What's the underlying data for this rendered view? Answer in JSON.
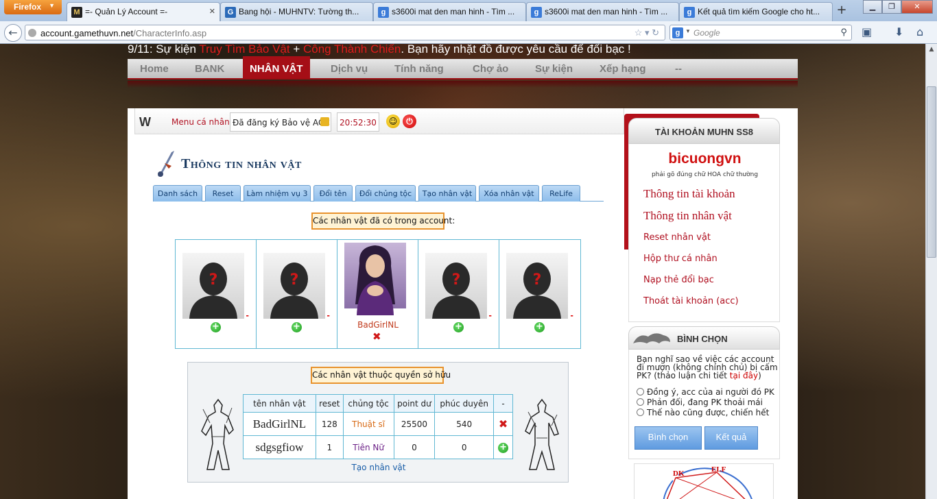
{
  "browser": {
    "menu_button": "Firefox",
    "tabs": [
      {
        "title": "=- Quản Lý Account =-",
        "active": true
      },
      {
        "title": "Bang hội - MUHNTV: Tường th...",
        "active": false
      },
      {
        "title": "s3600i mat den man hinh - Tìm ...",
        "active": false
      },
      {
        "title": "s3600i mat den man hinh - Tìm ...",
        "active": false
      },
      {
        "title": "Kết quả tìm kiếm Google cho ht...",
        "active": false
      }
    ],
    "url_host": "account.gamethuvn.net",
    "url_path": "/CharacterInfo.asp",
    "search_placeholder": "Google"
  },
  "news": {
    "prefix": "9/11: Sự kiện ",
    "event1": "Truy Tìm Bảo Vật",
    "plus": " + ",
    "event2": "Công Thành Chiến",
    "suffix": ". Bạn hãy nhặt đồ được yêu cầu để đổi bạc !"
  },
  "main_nav": [
    "Home",
    "BANK",
    "NHÂN VẬT",
    "Dịch vụ",
    "Tính năng",
    "Chợ ảo",
    "Sự kiện",
    "Xếp hạng",
    "--"
  ],
  "main_nav_active": "NHÂN VẬT",
  "topbar": {
    "menu_label": "Menu cá nhân",
    "account_status": "Đã đăng ký Bảo vệ ACC",
    "clock": "20:52:30"
  },
  "page_title": "Thông tin nhân vật",
  "sub_tabs": [
    "Danh sách",
    "Reset",
    "Làm nhiệm vụ 3",
    "Đổi tên",
    "Đổi chủng tộc",
    "Tạo nhân vật",
    "Xóa nhân vật",
    "ReLife"
  ],
  "slots_label": "Các nhân vật đã có trong account:",
  "slots": [
    {
      "filled": false,
      "name": "",
      "dash": "-"
    },
    {
      "filled": false,
      "name": "",
      "dash": "-"
    },
    {
      "filled": true,
      "name": "BadGirlNL",
      "dash": ""
    },
    {
      "filled": false,
      "name": "",
      "dash": "-"
    },
    {
      "filled": false,
      "name": "",
      "dash": "-"
    }
  ],
  "owned_label": "Các nhân vật thuộc quyền sở hữu",
  "table": {
    "headers": [
      "tên nhân vật",
      "reset",
      "chủng tộc",
      "point dư",
      "phúc duyên",
      "-"
    ],
    "rows": [
      {
        "name": "BadGirlNL",
        "reset": "128",
        "race": "Thuật sĩ",
        "point": "25500",
        "phuc": "540",
        "action": "delete"
      },
      {
        "name": "sdgsgfiow",
        "reset": "1",
        "race": "Tiên Nữ",
        "point": "0",
        "phuc": "0",
        "action": "add"
      }
    ]
  },
  "create_link": "Tạo nhân vật",
  "sidebar": {
    "header": "TÀI KHOẢN MUHN SS8",
    "username": "bicuongvn",
    "hint": "phải gõ đúng chữ HOA chữ thường",
    "links": [
      "Thông tin tài khoản",
      "Thông tin nhân vật",
      "Reset nhân vật",
      "Hộp thư cá nhân",
      "Nạp thẻ đổi bạc",
      "Thoát tài khoản (acc)"
    ]
  },
  "poll": {
    "title": "BÌNH CHỌN",
    "question": "Bạn nghĩ sao về việc các account đi mượn (không chính chủ) bị cấm PK? (thảo luận chi tiết ",
    "question_link": "tại đây",
    "question_end": ")",
    "options": [
      "Đồng ý, acc của ai người đó PK",
      "Phản đối, đang PK thoải mái",
      "Thế nào cũng được, chiến hết"
    ],
    "vote_button": "Bình chọn",
    "result_button": "Kết quả"
  },
  "banner_labels": [
    "DK",
    "ELF"
  ]
}
